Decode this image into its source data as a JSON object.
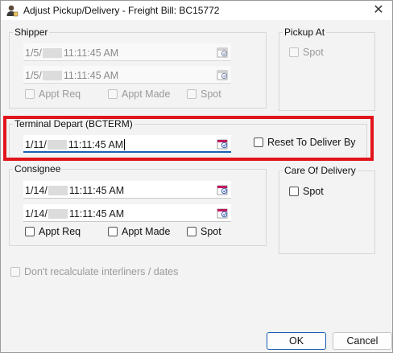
{
  "window": {
    "title": "Adjust Pickup/Delivery - Freight Bill: BC15772",
    "close_symbol": "✕",
    "app_icon": "user-edit-icon"
  },
  "shipper": {
    "legend": "Shipper",
    "date1": {
      "prefix": "1/5/",
      "time": "11:11:45 AM"
    },
    "date2": {
      "prefix": "1/5/",
      "time": "11:11:45 AM"
    },
    "appt_req_label": "Appt Req",
    "appt_made_label": "Appt Made",
    "spot_label": "Spot"
  },
  "pickup_at": {
    "legend": "Pickup At",
    "spot_label": "Spot"
  },
  "terminal_depart": {
    "legend": "Terminal Depart (BCTERM)",
    "date": {
      "prefix": "1/11/",
      "time": "11:11:45 AM"
    },
    "reset_label": "Reset To Deliver By"
  },
  "consignee": {
    "legend": "Consignee",
    "date1": {
      "prefix": "1/14/",
      "time": "11:11:45 AM"
    },
    "date2": {
      "prefix": "1/14/",
      "time": "11:11:45 AM"
    },
    "appt_req_label": "Appt Req",
    "appt_made_label": "Appt Made",
    "spot_label": "Spot"
  },
  "care_of_delivery": {
    "legend": "Care Of Delivery",
    "spot_label": "Spot"
  },
  "options": {
    "dont_recalc_label": "Don't recalculate interliners / dates"
  },
  "buttons": {
    "ok_label": "OK",
    "cancel_label": "Cancel"
  },
  "colors": {
    "highlight": "#e2141b",
    "focus": "#1a5fb4",
    "calendar_icon": "#c2185b"
  }
}
